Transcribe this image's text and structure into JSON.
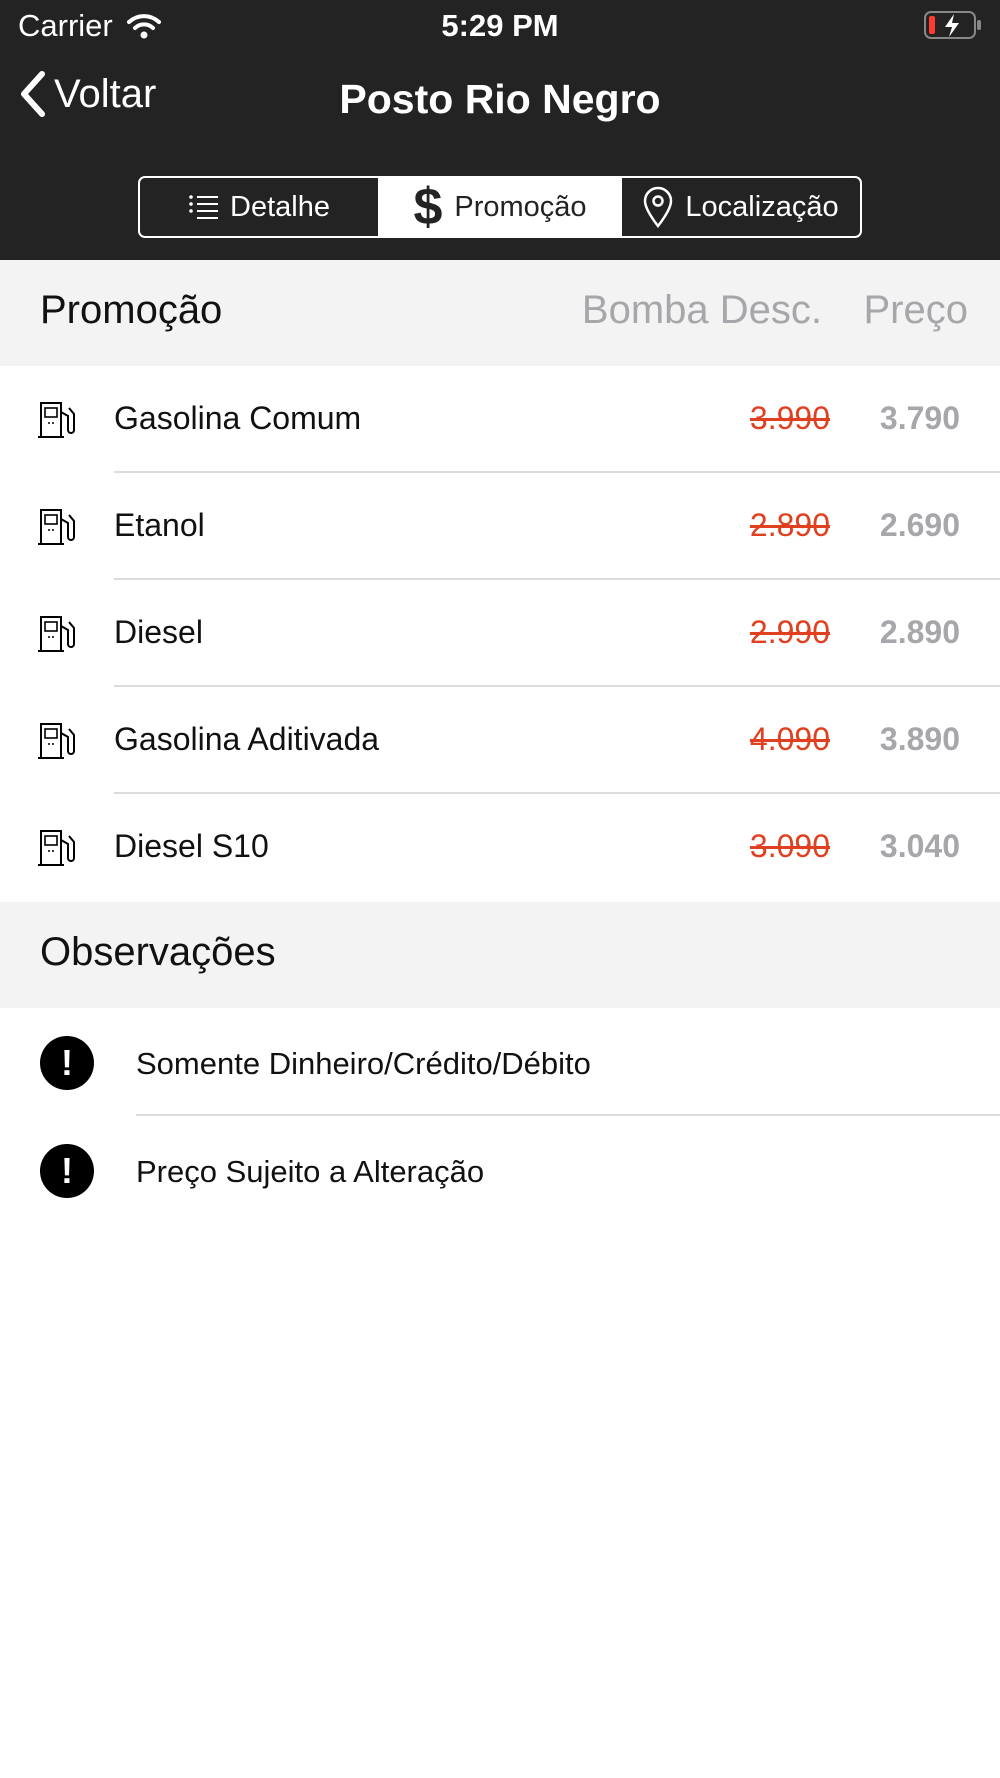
{
  "status_bar": {
    "carrier": "Carrier",
    "time": "5:29 PM"
  },
  "nav": {
    "back_label": "Voltar",
    "title": "Posto Rio Negro"
  },
  "segments": {
    "detalhe": "Detalhe",
    "promocao": "Promoção",
    "localizacao": "Localização",
    "selected": "Promoção"
  },
  "promo_header": {
    "title": "Promoção",
    "col_old": "Bomba Desc.",
    "col_new": "Preço"
  },
  "fuels": [
    {
      "name": "Gasolina Comum",
      "old_price": "3.990",
      "new_price": "3.790"
    },
    {
      "name": "Etanol",
      "old_price": "2.890",
      "new_price": "2.690"
    },
    {
      "name": "Diesel",
      "old_price": "2.990",
      "new_price": "2.890"
    },
    {
      "name": "Gasolina Aditivada",
      "old_price": "4.090",
      "new_price": "3.890"
    },
    {
      "name": "Diesel S10",
      "old_price": "3.090",
      "new_price": "3.040"
    }
  ],
  "obs_header": {
    "title": "Observações"
  },
  "observations": [
    {
      "icon_text": "!",
      "text": "Somente Dinheiro/Crédito/Débito"
    },
    {
      "icon_text": "!",
      "text": "Preço Sujeito a Alteração"
    }
  ],
  "colors": {
    "header_bg": "#232323",
    "strike_price": "#e0401f",
    "muted_text": "#a6a6ab",
    "section_bg": "#f3f3f3"
  },
  "icons": {
    "wifi": "wifi-icon",
    "battery": "battery-charging-icon",
    "back": "chevron-left-icon",
    "list": "list-icon",
    "dollar": "dollar-icon",
    "pin": "map-pin-icon",
    "fuel": "fuel-pump-icon",
    "alert": "exclamation-circle-icon"
  }
}
